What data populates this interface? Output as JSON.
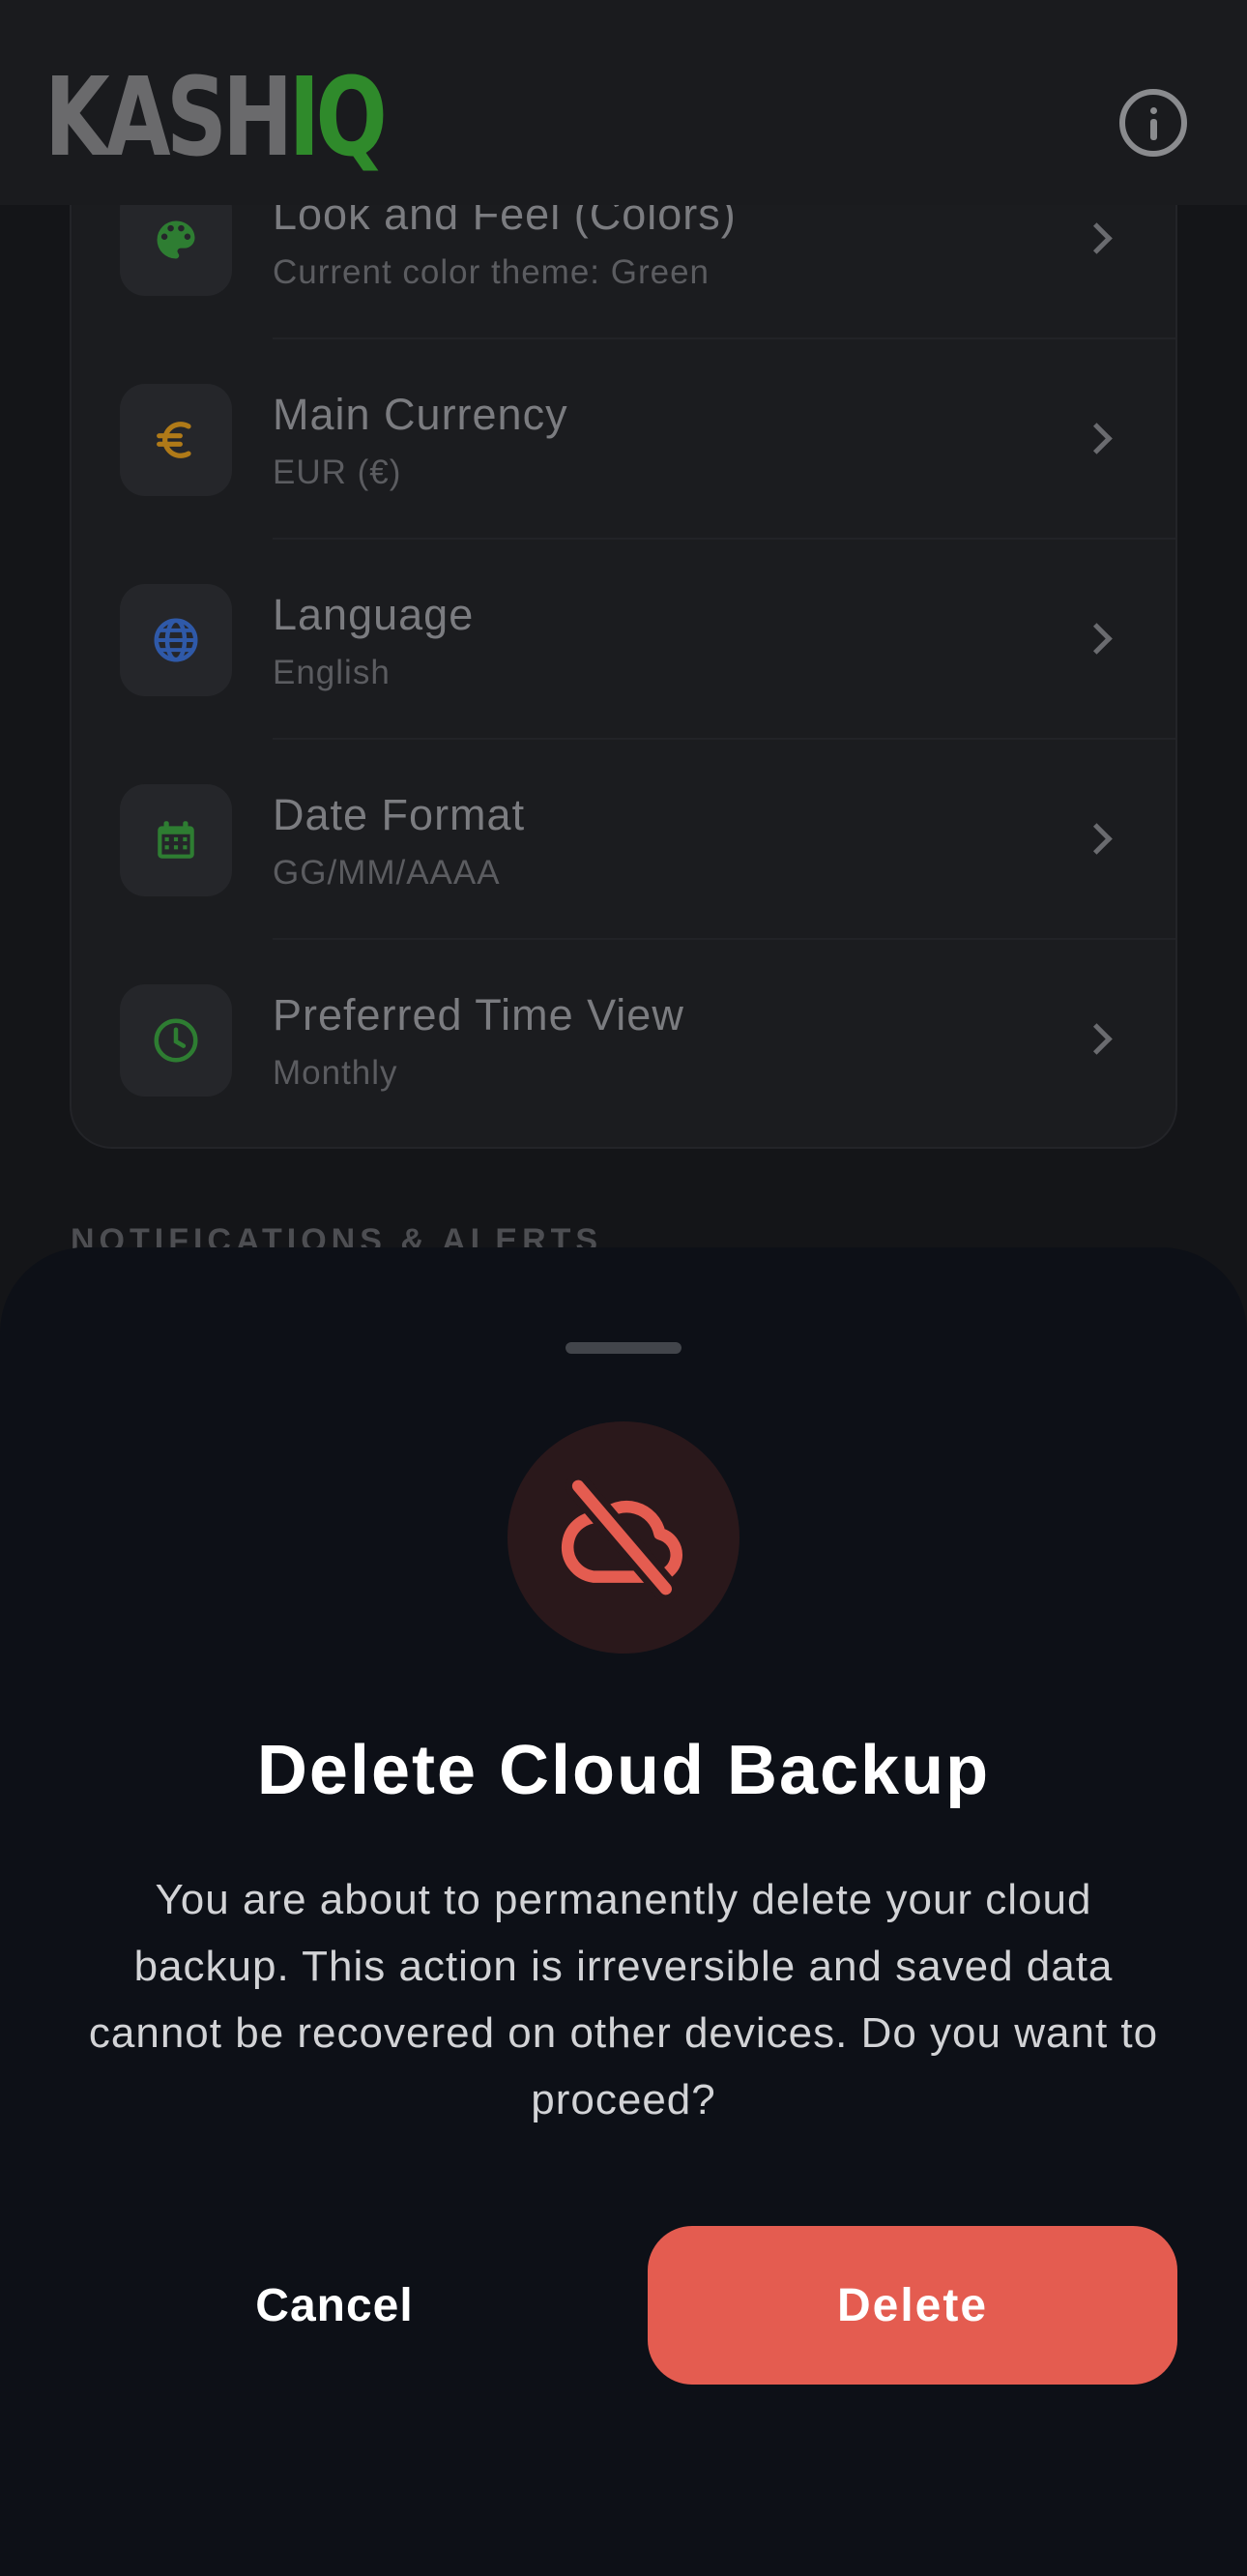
{
  "header": {
    "logo_part1": "KASH",
    "logo_part2": "IQ",
    "info_icon": "info-circle-icon"
  },
  "settings": {
    "items": [
      {
        "title": "Look and Feel (Colors)",
        "subtitle": "Current color theme: Green",
        "icon": "palette-icon",
        "icon_color": "#2e7d32"
      },
      {
        "title": "Main Currency",
        "subtitle": "EUR (€)",
        "icon": "euro-icon",
        "icon_color": "#b07a18"
      },
      {
        "title": "Language",
        "subtitle": "English",
        "icon": "globe-icon",
        "icon_color": "#2f59a8"
      },
      {
        "title": "Date Format",
        "subtitle": "GG/MM/AAAA",
        "icon": "calendar-icon",
        "icon_color": "#2e7d32"
      },
      {
        "title": "Preferred Time View",
        "subtitle": "Monthly",
        "icon": "clock-icon",
        "icon_color": "#2e7d32"
      }
    ],
    "next_section_label": "NOTIFICATIONS & ALERTS"
  },
  "dialog": {
    "icon": "cloud-off-icon",
    "title": "Delete Cloud Backup",
    "message": "You are about to permanently delete your cloud backup. This action is irreversible and saved data cannot be recovered on other devices. Do you want to proceed?",
    "cancel_label": "Cancel",
    "delete_label": "Delete",
    "accent_color": "#e45c50"
  }
}
